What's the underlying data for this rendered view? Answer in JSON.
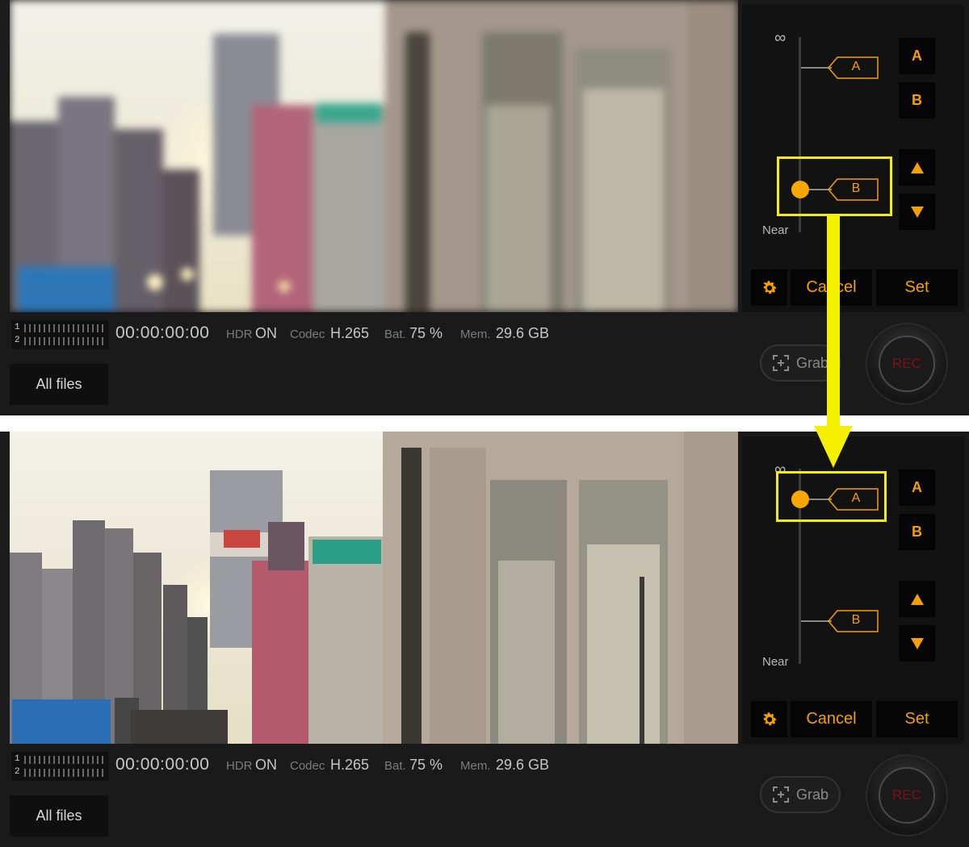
{
  "screens": [
    {
      "id": "before",
      "blurred": true,
      "meter": {
        "channels": [
          "1",
          "2"
        ]
      },
      "timecode": "00:00:00:00",
      "stats": {
        "hdr_label": "HDR",
        "hdr_value": "ON",
        "codec_label": "Codec",
        "codec_value": "H.265",
        "bat_label": "Bat.",
        "bat_value": "75 %",
        "mem_label": "Mem.",
        "mem_value": "29.6 GB"
      },
      "all_files": "All files",
      "focus": {
        "infinity": "∞",
        "near": "Near",
        "marker_a": "A",
        "marker_b": "B",
        "current": "B",
        "btn_a": "A",
        "btn_b": "B",
        "up_icon": "triangle-up-icon",
        "down_icon": "triangle-down-icon",
        "settings_icon": "gear-icon",
        "cancel": "Cancel",
        "set": "Set"
      },
      "grab": "Grab",
      "rec": "REC"
    },
    {
      "id": "after",
      "blurred": false,
      "meter": {
        "channels": [
          "1",
          "2"
        ]
      },
      "timecode": "00:00:00:00",
      "stats": {
        "hdr_label": "HDR",
        "hdr_value": "ON",
        "codec_label": "Codec",
        "codec_value": "H.265",
        "bat_label": "Bat.",
        "bat_value": "75 %",
        "mem_label": "Mem.",
        "mem_value": "29.6 GB"
      },
      "all_files": "All files",
      "focus": {
        "infinity": "∞",
        "near": "Near",
        "marker_a": "A",
        "marker_b": "B",
        "current": "A",
        "btn_a": "A",
        "btn_b": "B",
        "up_icon": "triangle-up-icon",
        "down_icon": "triangle-down-icon",
        "settings_icon": "gear-icon",
        "cancel": "Cancel",
        "set": "Set"
      },
      "grab": "Grab",
      "rec": "REC"
    }
  ],
  "annotation": {
    "color": "#f4f000",
    "arrow": "arrow-down-icon"
  },
  "colors": {
    "accent": "#f5a000",
    "rec": "#7a1313",
    "panel": "#121212"
  }
}
